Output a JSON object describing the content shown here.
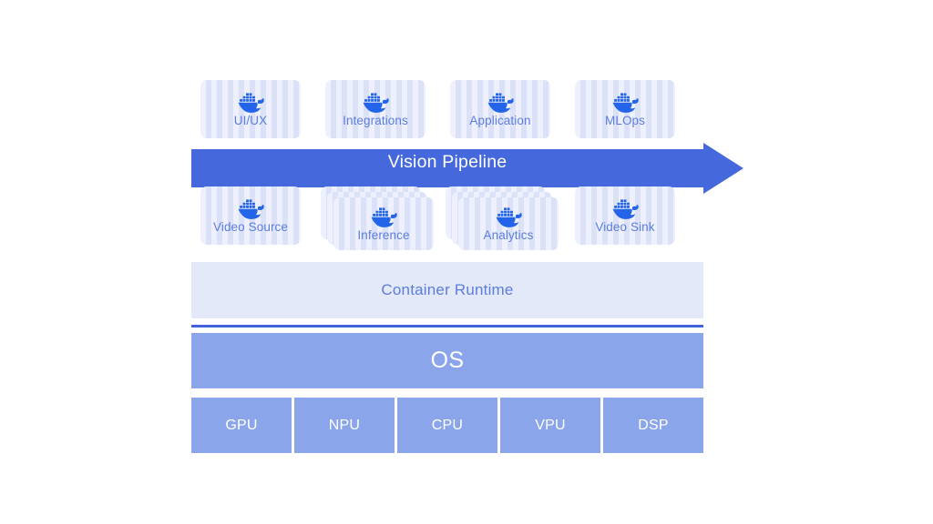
{
  "diagram": {
    "title": "Vision Pipeline container architecture stack",
    "colors": {
      "card_base": "#dfe5f9",
      "card_stripe_light": "#eef1fd",
      "card_stripe_dark": "#dbe2f8",
      "card_label_text": "#5b7de0",
      "docker_blue": "#2364e8",
      "arrow_blue": "#4569dd",
      "runtime_band": "#e4e9fa",
      "divider_blue": "#3f64dd",
      "os_band": "#8ba5ea",
      "hardware_box": "#8ba5ea",
      "white_text": "#ffffff",
      "background": "#ffffff"
    },
    "top_row": {
      "name": "application-layer-containers",
      "cards": [
        {
          "label": "UI/UX",
          "icon": "docker-icon",
          "stacked": false
        },
        {
          "label": "Integrations",
          "icon": "docker-icon",
          "stacked": false
        },
        {
          "label": "Application",
          "icon": "docker-icon",
          "stacked": false
        },
        {
          "label": "MLOps",
          "icon": "docker-icon",
          "stacked": false
        }
      ]
    },
    "pipeline": {
      "name": "vision-pipeline-arrow",
      "label": "Vision Pipeline",
      "direction": "right"
    },
    "bottom_row": {
      "name": "pipeline-stage-containers",
      "cards": [
        {
          "label": "Video Source",
          "icon": "docker-icon",
          "stacked": false
        },
        {
          "label": "Inference",
          "icon": "docker-icon",
          "stacked": true
        },
        {
          "label": "Analytics",
          "icon": "docker-icon",
          "stacked": true
        },
        {
          "label": "Video Sink",
          "icon": "docker-icon",
          "stacked": false
        }
      ]
    },
    "runtime": {
      "name": "container-runtime-band",
      "label": "Container Runtime"
    },
    "os": {
      "name": "os-band",
      "label": "OS"
    },
    "hardware": {
      "name": "hardware-accelerator-row",
      "boxes": [
        {
          "label": "GPU"
        },
        {
          "label": "NPU"
        },
        {
          "label": "CPU"
        },
        {
          "label": "VPU"
        },
        {
          "label": "DSP"
        }
      ]
    }
  }
}
